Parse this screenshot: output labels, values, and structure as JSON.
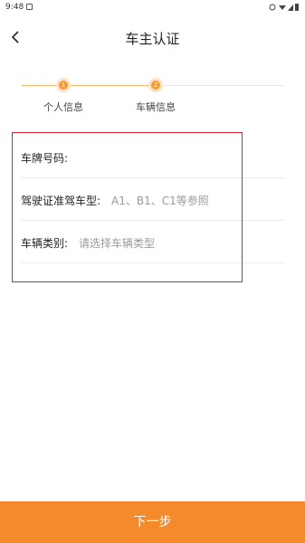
{
  "status_bar": {
    "time": "9:48"
  },
  "nav": {
    "title": "车主认证"
  },
  "stepper": {
    "steps": [
      {
        "number": "1",
        "label": "个人信息"
      },
      {
        "number": "2",
        "label": "车辆信息"
      }
    ]
  },
  "form": {
    "plate": {
      "label": "车牌号码:",
      "placeholder": ""
    },
    "license": {
      "label": "驾驶证准驾车型:",
      "placeholder": "A1、B1、C1等参照"
    },
    "vehicle_type": {
      "label": "车辆类别:",
      "placeholder": "请选择车辆类型"
    }
  },
  "footer": {
    "next_label": "下一步"
  },
  "colors": {
    "accent": "#f58a2a",
    "highlight_border": "#d9252e"
  }
}
